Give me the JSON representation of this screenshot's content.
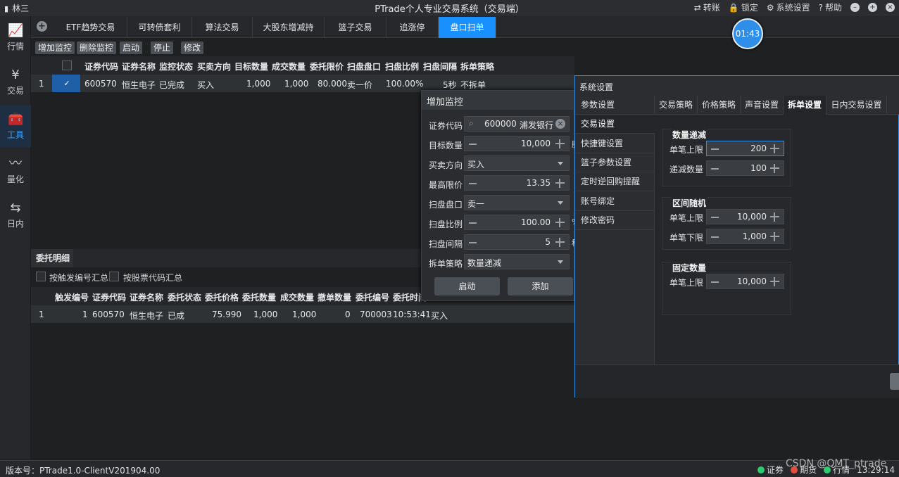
{
  "titlebar": {
    "user": "林三",
    "title": "PTrade个人专业交易系统（交易端）",
    "actions": [
      {
        "icon": "transfer-icon",
        "glyph": "⇄",
        "label": "转账"
      },
      {
        "icon": "lock-icon",
        "glyph": "🔒",
        "label": "锁定"
      },
      {
        "icon": "gear-icon",
        "glyph": "⚙",
        "label": "系统设置"
      },
      {
        "icon": "help-icon",
        "glyph": "?",
        "label": "帮助"
      }
    ]
  },
  "sidebar": {
    "items": [
      {
        "label": "行情",
        "icon": "chart-icon",
        "glyph": "📈"
      },
      {
        "label": "交易",
        "icon": "yen-icon",
        "glyph": "¥"
      },
      {
        "label": "工具",
        "icon": "toolbox-icon",
        "glyph": "🧰"
      },
      {
        "label": "量化",
        "icon": "pulse-icon",
        "glyph": "〰"
      },
      {
        "label": "日内",
        "icon": "intraday-icon",
        "glyph": "⇆"
      }
    ]
  },
  "tabs": [
    "ETF趋势交易",
    "可转债套利",
    "算法交易",
    "大股东增减持",
    "篮子交易",
    "追涨停",
    "盘口扫单"
  ],
  "clock": "01:43",
  "toolbar": {
    "buttons": [
      "增加监控",
      "删除监控",
      "启动",
      "停止",
      "修改"
    ]
  },
  "monitor_table": {
    "headers": [
      "证券代码",
      "证券名称",
      "监控状态",
      "买卖方向",
      "目标数量",
      "成交数量",
      "委托限价",
      "扫盘盘口",
      "扫盘比例",
      "扫盘间隔",
      "拆单策略"
    ],
    "rows": [
      {
        "index": "1",
        "code": "600570",
        "name": "恒生电子",
        "status": "已完成",
        "direction": "买入",
        "target": "1,000",
        "filled": "1,000",
        "limit": "80.000",
        "level": "卖一价",
        "ratio": "100.00%",
        "interval": "5秒",
        "strategy": "不拆单"
      }
    ]
  },
  "detail": {
    "title": "委托明细",
    "options": [
      "按触发编号汇总",
      "按股票代码汇总"
    ],
    "headers": [
      "触发编号",
      "证券代码",
      "证券名称",
      "委托状态",
      "委托价格",
      "委托数量",
      "成交数量",
      "撤单数量",
      "委托编号",
      "委托时间"
    ],
    "rows": [
      {
        "index": "1",
        "trigger": "1",
        "code": "600570",
        "name": "恒生电子",
        "status": "已成",
        "price": "75.990",
        "qty": "1,000",
        "filled": "1,000",
        "cancel": "0",
        "order_no": "700003",
        "time": "10:53:41",
        "dir": "买入"
      }
    ]
  },
  "add_monitor": {
    "title": "增加监控",
    "fields": {
      "code_label": "证券代码",
      "code_value": "600000",
      "code_name": "浦发银行",
      "qty_label": "目标数量",
      "qty_value": "10,000",
      "qty_suffix": "股",
      "dir_label": "买卖方向",
      "dir_value": "买入",
      "price_label": "最高限价",
      "price_value": "13.35",
      "level_label": "扫盘盘口",
      "level_value": "卖一",
      "ratio_label": "扫盘比例",
      "ratio_value": "100.00",
      "ratio_suffix": "%",
      "interval_label": "扫盘间隔",
      "interval_value": "5",
      "interval_suffix": "秒",
      "strategy_label": "拆单策略",
      "strategy_value": "数量递减"
    },
    "start_button": "启动",
    "add_button": "添加"
  },
  "system_settings": {
    "title": "系统设置",
    "left_items": [
      "参数设置",
      "交易设置",
      "快捷键设置",
      "篮子参数设置",
      "定时逆回购提醒",
      "账号绑定",
      "修改密码"
    ],
    "tabs": [
      "交易策略",
      "价格策略",
      "声音设置",
      "拆单设置",
      "日内交易设置"
    ],
    "groups": {
      "decrease": {
        "title": "数量递减",
        "max_label": "单笔上限",
        "max_value": "200",
        "step_label": "递减数量",
        "step_value": "100"
      },
      "random": {
        "title": "区间随机",
        "max_label": "单笔上限",
        "max_value": "10,000",
        "min_label": "单笔下限",
        "min_value": "1,000"
      },
      "fixed": {
        "title": "固定数量",
        "max_label": "单笔上限",
        "max_value": "10,000"
      }
    }
  },
  "statusbar": {
    "version": "版本号：PTrade1.0-ClientV201904.00",
    "items": [
      {
        "label": "证券",
        "color": "#2ecc71"
      },
      {
        "label": "期货",
        "color": "#e74c3c"
      },
      {
        "label": "行情",
        "color": "#2ecc71"
      }
    ],
    "time": "13:29:14",
    "watermark": "CSDN @QMT_ptrade"
  }
}
